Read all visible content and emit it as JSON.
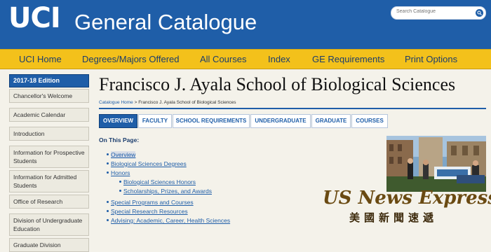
{
  "header": {
    "logo": "UCI",
    "title": "General Catalogue",
    "search_placeholder": "Search Catalogue"
  },
  "nav": [
    "UCI Home",
    "Degrees/Majors Offered",
    "All Courses",
    "Index",
    "GE Requirements",
    "Print Options"
  ],
  "sidebar": {
    "edition": "2017-18 Edition",
    "items": [
      "Chancellor's Welcome",
      "Academic Calendar",
      "Introduction",
      "Information for Prospective Students",
      "Information for Admitted Students",
      "Office of Research",
      "Division of Undergraduate Education",
      "Graduate Division"
    ]
  },
  "main": {
    "title": "Francisco J. Ayala School of Biological Sciences",
    "breadcrumb": {
      "home": "Catalogue Home",
      "sep": " > ",
      "current": "Francisco J. Ayala School of Biological Sciences"
    },
    "tabs": [
      "OVERVIEW",
      "FACULTY",
      "SCHOOL REQUIREMENTS",
      "UNDERGRADUATE",
      "GRADUATE",
      "COURSES"
    ],
    "on_this_page": "On This Page:",
    "links": [
      {
        "label": "Overview",
        "level": 0
      },
      {
        "label": "Biological Sciences Degrees",
        "level": 0
      },
      {
        "label": "Honors",
        "level": 0
      },
      {
        "label": "Biological Sciences Honors",
        "level": 1
      },
      {
        "label": "Scholarships, Prizes, and Awards",
        "level": 1
      },
      {
        "label": "Special Programs and Courses",
        "level": 0
      },
      {
        "label": "Special Research Resources",
        "level": 0
      },
      {
        "label": "Advising: Academic, Career, Health Sciences",
        "level": 0
      }
    ]
  },
  "watermark": {
    "en": "US News Express",
    "cn": "美國新聞速遞"
  },
  "colors": {
    "header_blue": "#1f5ea8",
    "nav_yellow": "#f3c11b",
    "page_bg": "#f4f2ea"
  }
}
